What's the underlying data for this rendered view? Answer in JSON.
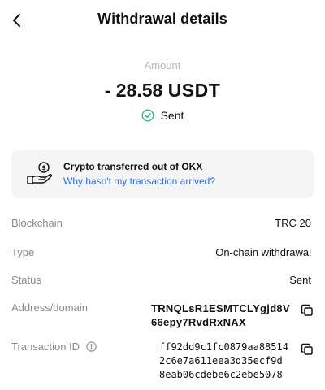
{
  "header": {
    "title": "Withdrawal details"
  },
  "summary": {
    "amount_label": "Amount",
    "amount_value": "- 28.58",
    "currency": "USDT",
    "status": "Sent"
  },
  "notice": {
    "title": "Crypto transferred out of OKX",
    "link": "Why hasn't my transaction arrived?"
  },
  "details": {
    "blockchain": {
      "label": "Blockchain",
      "value": "TRC 20"
    },
    "type": {
      "label": "Type",
      "value": "On-chain withdrawal"
    },
    "status": {
      "label": "Status",
      "value": "Sent"
    },
    "address": {
      "label": "Address/domain",
      "line1": "TRNQLsR1ESMTCLYgjd8V",
      "line2": "66epy7RvdRxNAX"
    },
    "txid": {
      "label": "Transaction ID",
      "line1": "ff92dd9c1fc0879aa88514",
      "line2": "2c6e7a611eea3d35ecf9d",
      "line3": "8eab06cdebe6c2ebe5078"
    }
  },
  "icons": {
    "back": "chevron-left-icon",
    "sent": "check-circle-icon",
    "notice": "hand-coin-icon",
    "info": "info-icon",
    "copy": "copy-icon"
  },
  "colors": {
    "success": "#2eb67d",
    "link": "#2a6ae0",
    "muted": "#8a8a8a"
  }
}
